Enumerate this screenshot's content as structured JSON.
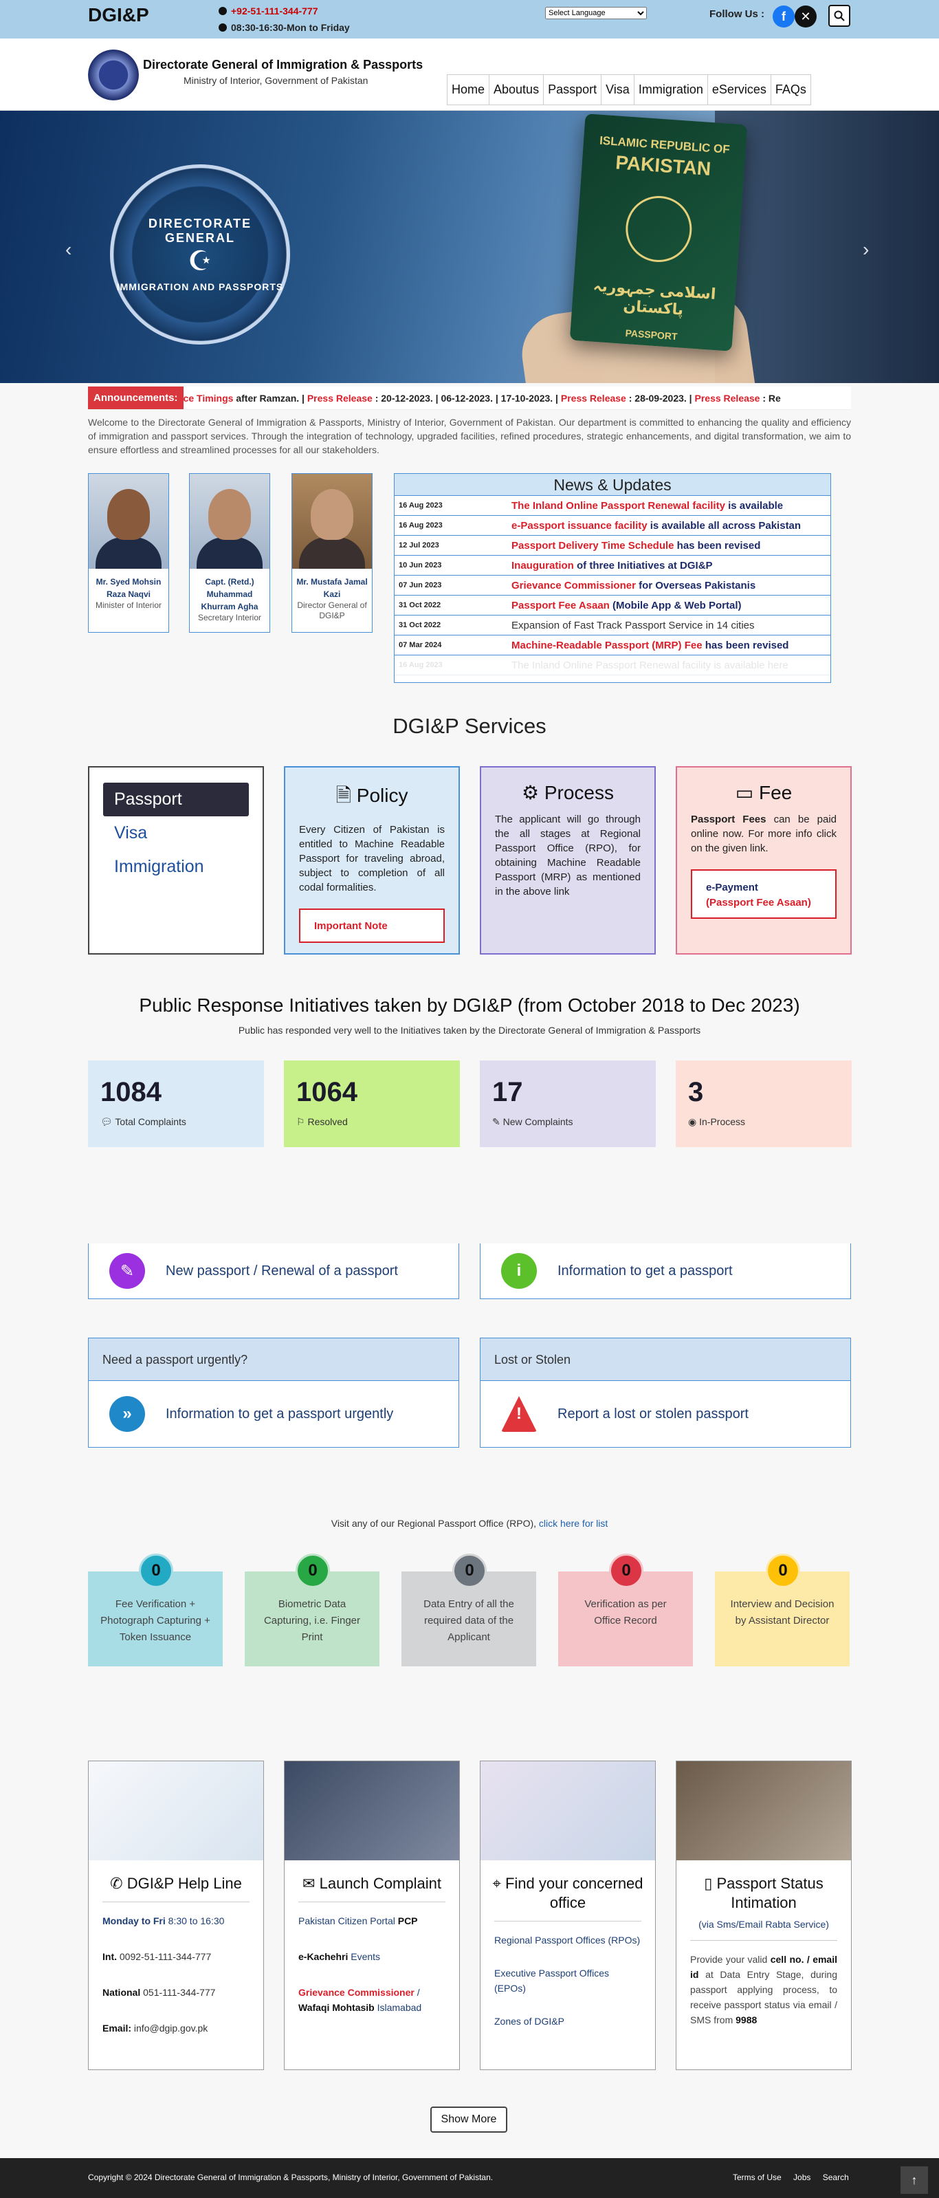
{
  "topbar": {
    "brand": "DGI&P",
    "phone": "+92-51-111-344-777",
    "hours": "08:30-16:30-Mon to Friday",
    "language_select": "Select Language",
    "follow_label": "Follow Us :"
  },
  "header": {
    "org_name": "Directorate General of Immigration & Passports",
    "org_sub": "Ministry of Interior, Government of Pakistan",
    "nav": [
      "Home",
      "Aboutus",
      "Passport",
      "Visa",
      "Immigration",
      "eServices",
      "FAQs"
    ]
  },
  "banner": {
    "seal_line1": "DIRECTORATE GENERAL",
    "seal_line2": "IMMIGRATION AND PASSPORTS",
    "passport_line1": "ISLAMIC REPUBLIC OF",
    "passport_line2": "PAKISTAN",
    "passport_line3": "اسلامی جمہوریہ پاکستان",
    "passport_line4": "PASSPORT"
  },
  "announcement": {
    "label": "Announcements:",
    "ticker": [
      {
        "text": "fice Timings",
        "style": "red"
      },
      {
        "text": " after Ramzan.",
        "style": "plain"
      },
      {
        "text": " | ",
        "style": "plain"
      },
      {
        "text": "Press Release",
        "style": "red"
      },
      {
        "text": " : 20-12-2023.",
        "style": "plain"
      },
      {
        "text": " | 06-12-2023. | 17-10-2023. | ",
        "style": "plain"
      },
      {
        "text": "Press Release",
        "style": "red"
      },
      {
        "text": " : 28-09-2023.",
        "style": "plain"
      },
      {
        "text": " | ",
        "style": "plain"
      },
      {
        "text": "Press Release",
        "style": "red"
      },
      {
        "text": " : Re",
        "style": "plain"
      }
    ]
  },
  "intro": "Welcome to the Directorate General of Immigration & Passports, Ministry of Interior, Government of Pakistan. Our department is committed to enhancing the quality and efficiency of immigration and passport services. Through the integration of technology, upgraded facilities, refined procedures, strategic enhancements, and digital transformation, we aim to ensure effortless and streamlined processes for all our stakeholders.",
  "officials": [
    {
      "name": "Mr. Syed Mohsin Raza Naqvi",
      "title": "Minister of Interior"
    },
    {
      "name": "Capt. (Retd.) Muhammad Khurram Agha",
      "title": "Secretary Interior"
    },
    {
      "name": "Mr. Mustafa Jamal Kazi",
      "title": "Director General of DGI&P"
    }
  ],
  "news": {
    "heading": "News & Updates",
    "items": [
      {
        "date": "16 Aug 2023",
        "red": "The Inland Online Passport Renewal facility",
        "rest": " is available"
      },
      {
        "date": "16 Aug 2023",
        "red": "e-Passport issuance facility",
        "rest": " is available all across Pakistan"
      },
      {
        "date": "12 Jul 2023",
        "red": "Passport Delivery Time Schedule",
        "rest": " has been revised"
      },
      {
        "date": "10 Jun 2023",
        "red": "Inauguration",
        "rest": " of three Initiatives at DGI&P"
      },
      {
        "date": "07 Jun 2023",
        "red": "Grievance Commissioner",
        "rest": " for Overseas Pakistanis"
      },
      {
        "date": "31 Oct 2022",
        "red": "Passport Fee Asaan",
        "rest": " (Mobile App & Web Portal)"
      },
      {
        "date": "31 Oct 2022",
        "red": "",
        "rest": "Expansion of Fast Track Passport Service in 14 cities"
      },
      {
        "date": "07 Mar 2024",
        "red": "Machine-Readable Passport (MRP) Fee",
        "rest": " has been revised"
      },
      {
        "date": "16 Aug 2023",
        "red": "",
        "rest": "The Inland Online Passport Renewal facility is available here"
      }
    ]
  },
  "services": {
    "title": "DGI&P Services",
    "tabs": [
      "Passport",
      "Visa",
      "Immigration"
    ],
    "policy": {
      "title": "Policy",
      "text": "Every Citizen of Pakistan is entitled to Machine Readable Passport for traveling abroad, subject to completion of all codal formalities.",
      "button": "Important Note"
    },
    "process": {
      "title": "Process",
      "text": "The applicant will go through the all stages at Regional Passport Office (RPO), for obtaining Machine Readable Passport (MRP) as mentioned in the above link"
    },
    "fee": {
      "title": "Fee",
      "text_bold": "Passport Fees",
      "text": " can be paid online now. For more info click on the given link.",
      "link1": "e-Payment",
      "link2": "(Passport Fee Asaan)"
    }
  },
  "initiatives": {
    "title": "Public Response Initiatives taken by DGI&P (from October 2018 to Dec 2023)",
    "subtitle": "Public has responded very well to the Initiatives taken by the Directorate General of Immigration & Passports",
    "stats": [
      {
        "value": "1084",
        "label": "Total Complaints",
        "icon": "comment-icon"
      },
      {
        "value": "1064",
        "label": "Resolved",
        "icon": "flag-icon"
      },
      {
        "value": "17",
        "label": "New Complaints",
        "icon": "edit-icon"
      },
      {
        "value": "3",
        "label": "In-Process",
        "icon": "eye-icon"
      }
    ]
  },
  "faq_cards": [
    {
      "header": "",
      "text": "New passport / Renewal of a passport",
      "icon": "pencil-icon",
      "color": "#9b30e0"
    },
    {
      "header": "",
      "text": "Information to get a passport",
      "icon": "info-icon",
      "color": "#5cc02a"
    },
    {
      "header": "Need a passport urgently?",
      "text": "Information to get a passport urgently",
      "icon": "double-chevron-icon",
      "color": "#1f88c8"
    },
    {
      "header": "Lost or Stolen",
      "text": "Report a lost or stolen passport",
      "icon": "warning-icon",
      "color": "#e0353a"
    }
  ],
  "rpo": {
    "text": "Visit any of our Regional Passport Office (RPO),",
    "link": "click here for list",
    "steps": [
      {
        "count": "0",
        "label": "Fee Verification + Photograph Capturing + Token Issuance",
        "bg": "#a8dde6",
        "circle": "#22a9c4"
      },
      {
        "count": "0",
        "label": "Biometric Data Capturing, i.e. Finger Print",
        "bg": "#bfe3c8",
        "circle": "#28a745"
      },
      {
        "count": "0",
        "label": "Data Entry of all the required data of the Applicant",
        "bg": "#d3d4d6",
        "circle": "#6c757d"
      },
      {
        "count": "0",
        "label": "Verification as per Office Record",
        "bg": "#f5c4c8",
        "circle": "#dc3545"
      },
      {
        "count": "0",
        "label": "Interview and Decision by Assistant Director",
        "bg": "#fde9a8",
        "circle": "#ffc107"
      }
    ]
  },
  "bottom_cards": {
    "helpline": {
      "title": "DGI&P Help Line",
      "days_label": "Monday to Fri",
      "days": "8:30 to 16:30",
      "int_label": "Int.",
      "int": "0092-51-111-344-777",
      "nat_label": "National",
      "nat": "051-111-344-777",
      "email_label": "Email:",
      "email": "info@dgip.gov.pk"
    },
    "complaint": {
      "title": "Launch Complaint",
      "l1": "Pakistan Citizen Portal",
      "l1b": "PCP",
      "l2b": "e-Kachehri",
      "l2": "Events",
      "l3r": "Grievance Commissioner",
      "l3": " / ",
      "l3b": "Wafaqi Mohtasib",
      "l3c": "Islamabad"
    },
    "office": {
      "title": "Find your concerned office",
      "l1": "Regional Passport Offices (RPOs)",
      "l2": "Executive Passport Offices (EPOs)",
      "l3": "Zones of DGI&P"
    },
    "status": {
      "title": "Passport Status Intimation",
      "sub": "(via Sms/Email Rabta Service)",
      "p1": "Provide your valid ",
      "p1b": "cell no. / email id",
      "p2": " at Data Entry Stage, during passport applying process, to receive passport status via email / SMS from ",
      "p2b": "9988"
    }
  },
  "show_more": "Show More",
  "footer": {
    "copyright": "Copyright © 2024 Directorate General of Immigration & Passports, Ministry of Interior, Government of Pakistan.",
    "links": [
      "Terms of Use",
      "Jobs",
      "Search"
    ]
  }
}
